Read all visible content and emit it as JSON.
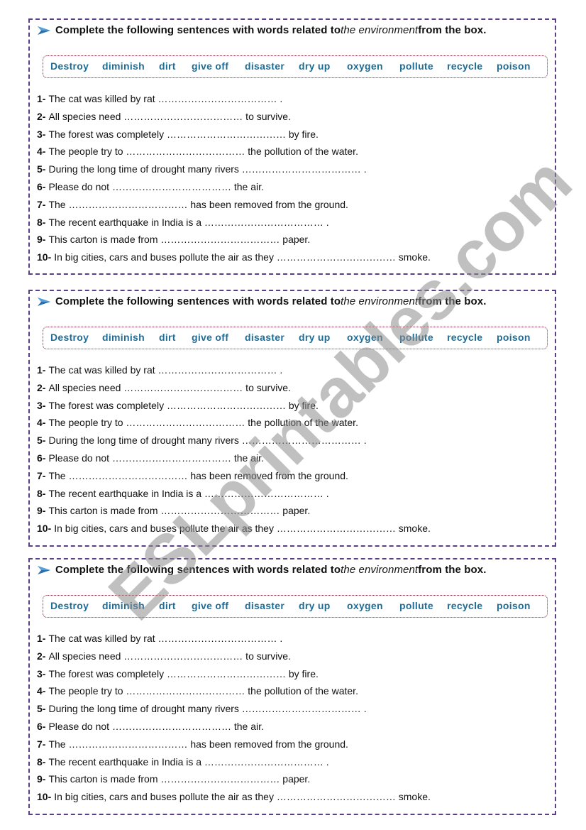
{
  "exercises": [
    {
      "instruction": {
        "prefix": "Complete the following sentences with words related to ",
        "emphasis": "the environment",
        "suffix": "from the box."
      },
      "word_box": [
        "Destroy",
        "diminish",
        "dirt",
        "give off",
        "disaster",
        "dry up",
        "oxygen",
        "pollute",
        "recycle",
        "poison"
      ],
      "sentences": [
        {
          "num": "1-",
          "text": "The cat was killed by rat ……………………………… ."
        },
        {
          "num": "2-",
          "text": "All species need ……………………………… to survive."
        },
        {
          "num": "3-",
          "text": "The forest was completely ……………………………… by fire."
        },
        {
          "num": "4-",
          "text": "The people try to ……………………………… the pollution of the water."
        },
        {
          "num": "5-",
          "text": "During the long time of drought many rivers ……………………………… ."
        },
        {
          "num": "6-",
          "text": "Please do not ……………………………… the air."
        },
        {
          "num": "7-",
          "text": "The ……………………………… has been removed from the ground."
        },
        {
          "num": "8-",
          "text": "The recent earthquake in India is a ……………………………… ."
        },
        {
          "num": "9-",
          "text": "This carton is made from ……………………………… paper."
        },
        {
          "num": "10-",
          "text": "In big cities, cars and buses pollute the air as they ……………………………… smoke."
        }
      ]
    },
    {
      "instruction": {
        "prefix": "Complete the following sentences with words related to ",
        "emphasis": "the environment",
        "suffix": "from the box."
      },
      "word_box": [
        "Destroy",
        "diminish",
        "dirt",
        "give off",
        "disaster",
        "dry up",
        "oxygen",
        "pollute",
        "recycle",
        "poison"
      ],
      "sentences": [
        {
          "num": "1-",
          "text": "The cat was killed by rat ……………………………… ."
        },
        {
          "num": "2-",
          "text": "All species need ……………………………… to survive."
        },
        {
          "num": "3-",
          "text": "The forest was completely ……………………………… by fire."
        },
        {
          "num": "4-",
          "text": "The people try to ……………………………… the pollution of the water."
        },
        {
          "num": "5-",
          "text": "During the long time of drought many rivers ……………………………… ."
        },
        {
          "num": "6-",
          "text": "Please do not ……………………………… the air."
        },
        {
          "num": "7-",
          "text": "The ……………………………… has been removed from the ground."
        },
        {
          "num": "8-",
          "text": "The recent earthquake in India is a ……………………………… ."
        },
        {
          "num": "9-",
          "text": "This carton is made from ……………………………… paper."
        },
        {
          "num": "10-",
          "text": "In big cities, cars and buses pollute the air as they ……………………………… smoke."
        }
      ]
    },
    {
      "instruction": {
        "prefix": "Complete the following sentences with words related to ",
        "emphasis": "the environment",
        "suffix": "from the box."
      },
      "word_box": [
        "Destroy",
        "diminish",
        "dirt",
        "give off",
        "disaster",
        "dry up",
        "oxygen",
        "pollute",
        "recycle",
        "poison"
      ],
      "sentences": [
        {
          "num": "1-",
          "text": "The cat was killed by rat ……………………………… ."
        },
        {
          "num": "2-",
          "text": "All species need ……………………………… to survive."
        },
        {
          "num": "3-",
          "text": "The forest was completely ……………………………… by fire."
        },
        {
          "num": "4-",
          "text": "The people try to ……………………………… the pollution of the water."
        },
        {
          "num": "5-",
          "text": "During the long time of drought many rivers ……………………………… ."
        },
        {
          "num": "6-",
          "text": "Please do not ……………………………… the air."
        },
        {
          "num": "7-",
          "text": "The ……………………………… has been removed from the ground."
        },
        {
          "num": "8-",
          "text": "The recent earthquake in India is a ……………………………… ."
        },
        {
          "num": "9-",
          "text": "This carton is made from ……………………………… paper."
        },
        {
          "num": "10-",
          "text": "In big cities, cars and buses pollute the air as they ……………………………… smoke."
        }
      ]
    }
  ],
  "watermark": "ESLprintables.com",
  "colors": {
    "border": "#5b3f86",
    "word_box_text": "#1e6d97",
    "word_box_border": "#7a2a3a",
    "arrow": "#2a6fb0"
  }
}
